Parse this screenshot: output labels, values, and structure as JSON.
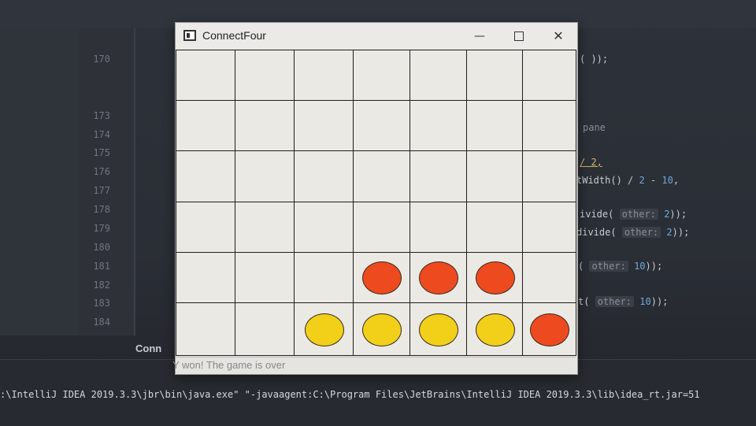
{
  "window": {
    "title": "ConnectFour",
    "controls": {
      "minimize": "—",
      "close": "✕"
    },
    "status": "Y won! The game is over"
  },
  "board": {
    "rows": 6,
    "columns": 7,
    "colors": {
      "red": "#ee4a1f",
      "yellow": "#f2d01a",
      "empty": "#ebe9e4"
    },
    "cells": [
      [
        "",
        "",
        "",
        "",
        "",
        "",
        ""
      ],
      [
        "",
        "",
        "",
        "",
        "",
        "",
        ""
      ],
      [
        "",
        "",
        "",
        "",
        "",
        "",
        ""
      ],
      [
        "",
        "",
        "",
        "",
        "",
        "",
        ""
      ],
      [
        "",
        "",
        "",
        "R",
        "R",
        "R",
        ""
      ],
      [
        "",
        "",
        "Y",
        "Y",
        "Y",
        "Y",
        "R"
      ]
    ]
  },
  "ide": {
    "line_numbers": [
      "170",
      "173",
      "174",
      "175",
      "176",
      "177",
      "178",
      "179",
      "180",
      "181",
      "182",
      "183",
      "184"
    ],
    "code": {
      "l170": "(   ));",
      "l174": "pane",
      "l175": "/ 2,",
      "l176a": "tWidth() / ",
      "l176b": "2",
      "l176c": " - ",
      "l176d": "10",
      "l176e": ",",
      "l178a": "ivide(",
      "l178b": "other:",
      "l178c": "2",
      "l178d": "));",
      "l179a": "divide(",
      "l179b": "other:",
      "l179c": "2",
      "l179d": "));",
      "l181a": "(",
      "l181b": "other:",
      "l181c": "10",
      "l181d": "));",
      "l183a": "t(",
      "l183b": "other:",
      "l183c": "10",
      "l183d": "));"
    },
    "tab_label": "Conn",
    "run_command": ":\\IntelliJ IDEA 2019.3.3\\jbr\\bin\\java.exe\" \"-javaagent:C:\\Program Files\\JetBrains\\IntelliJ IDEA 2019.3.3\\lib\\idea_rt.jar=51"
  }
}
